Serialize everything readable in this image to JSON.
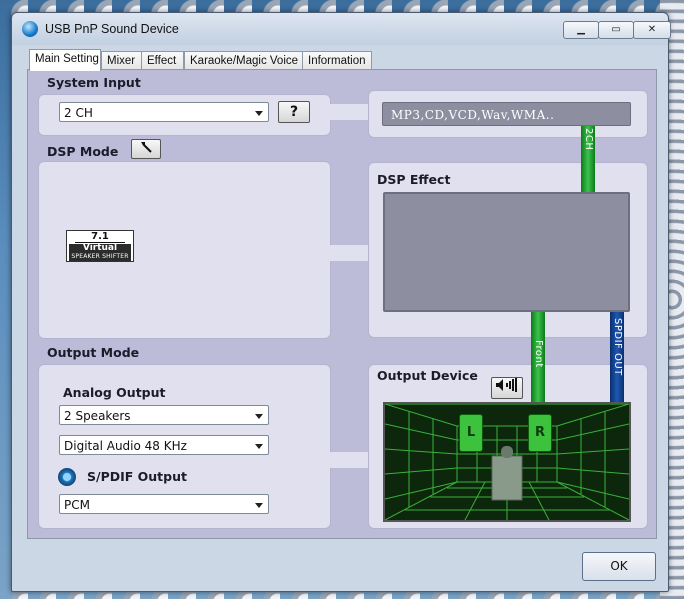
{
  "window": {
    "title": "USB PnP Sound Device"
  },
  "tabs": [
    {
      "label": "Main Setting",
      "active": true
    },
    {
      "label": "Mixer",
      "active": false
    },
    {
      "label": "Effect",
      "active": false
    },
    {
      "label": "Karaoke/Magic Voice",
      "active": false
    },
    {
      "label": "Information",
      "active": false
    }
  ],
  "system_input": {
    "heading": "System Input",
    "selected": "2 CH",
    "help_label": "?",
    "media_formats": "MP3,CD,VCD,Wav,WMA.."
  },
  "dsp_mode": {
    "heading": "DSP Mode",
    "badge": {
      "line1": "7.1",
      "line2": "Virtual",
      "line3": "SPEAKER SHIFTER"
    }
  },
  "dsp_effect": {
    "heading": "DSP Effect"
  },
  "signal_labels": {
    "ch2": "2CH",
    "front": "Front",
    "spdif_out": "SPDIF OUT"
  },
  "output_mode": {
    "heading": "Output Mode",
    "analog_heading": "Analog Output",
    "speakers_selected": "2 Speakers",
    "digital_selected": "Digital Audio 48 KHz",
    "spdif_heading": "S/PDIF Output",
    "spdif_selected": "PCM"
  },
  "output_device": {
    "heading": "Output Device",
    "speaker_left": "L",
    "speaker_right": "R"
  },
  "footer": {
    "ok_label": "OK"
  },
  "colors": {
    "panel": "#e0e0ee",
    "content_bg": "#bcbcd8",
    "green_bar": "#2fb03c",
    "blue_bar": "#163f88",
    "room_grid": "#3fbf3f"
  }
}
